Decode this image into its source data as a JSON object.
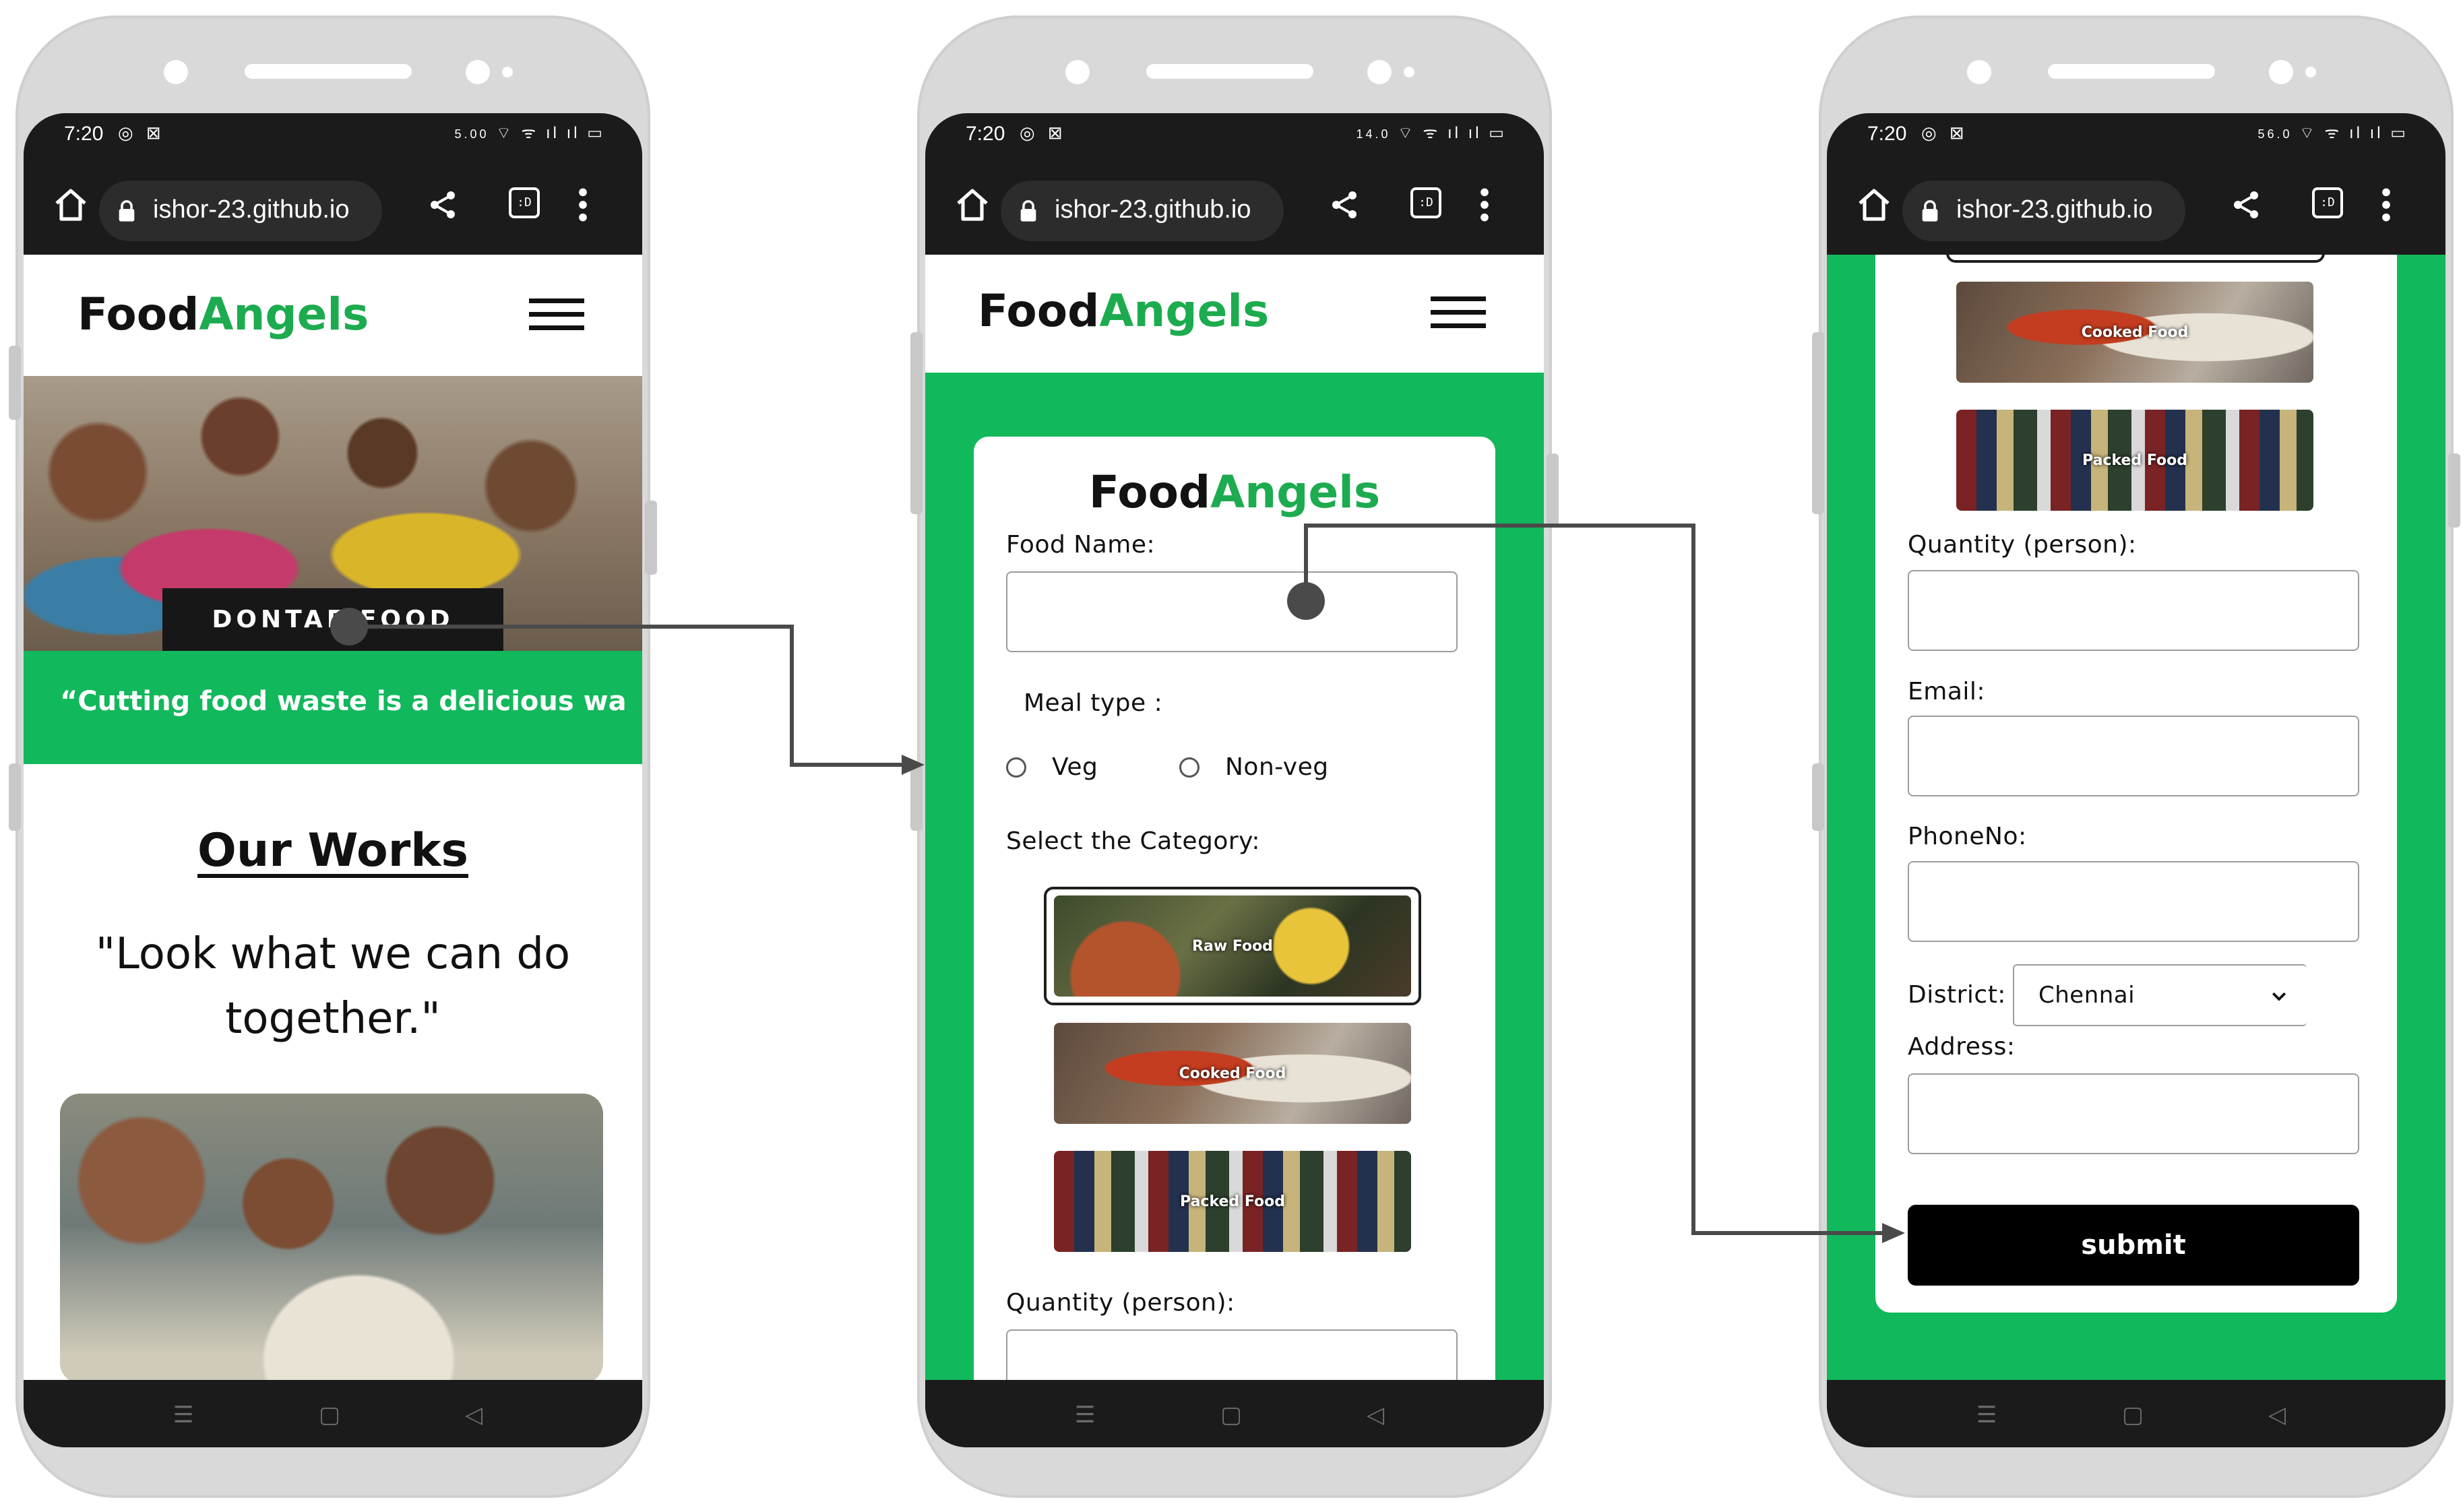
{
  "status_bar": {
    "time": "7:20",
    "signal_rates": [
      "5.00",
      "14.0",
      "56.0"
    ]
  },
  "browser": {
    "url": "ishor-23.github.io",
    "tabs_icon": ":D"
  },
  "logo": {
    "part1": "Food",
    "part2": "Angels"
  },
  "screen1": {
    "hero_button": "DONTAE FOOD",
    "quote_banner": "“Cutting food waste is a delicious wa",
    "section_title": "Our Works",
    "tagline_line1": "\"Look what we can do",
    "tagline_line2": "together.\""
  },
  "screen2": {
    "form_title_part1": "Food",
    "form_title_part2": "Angels",
    "food_name_label": "Food Name:",
    "meal_type_label": "Meal type :",
    "meal_options": [
      "Veg",
      "Non-veg"
    ],
    "category_label": "Select the Category:",
    "categories": [
      "Raw Food",
      "Cooked Food",
      "Packed Food"
    ],
    "quantity_label": "Quantity (person):"
  },
  "screen3": {
    "categories": [
      "Cooked Food",
      "Packed Food"
    ],
    "quantity_label": "Quantity (person):",
    "email_label": "Email:",
    "phone_label": "PhoneNo:",
    "district_label": "District:",
    "district_value": "Chennai",
    "address_label": "Address:",
    "submit_label": "submit"
  },
  "colors": {
    "brand_green": "#1dab4f",
    "banner_green": "#12b85c",
    "dark": "#1b1b1b"
  }
}
